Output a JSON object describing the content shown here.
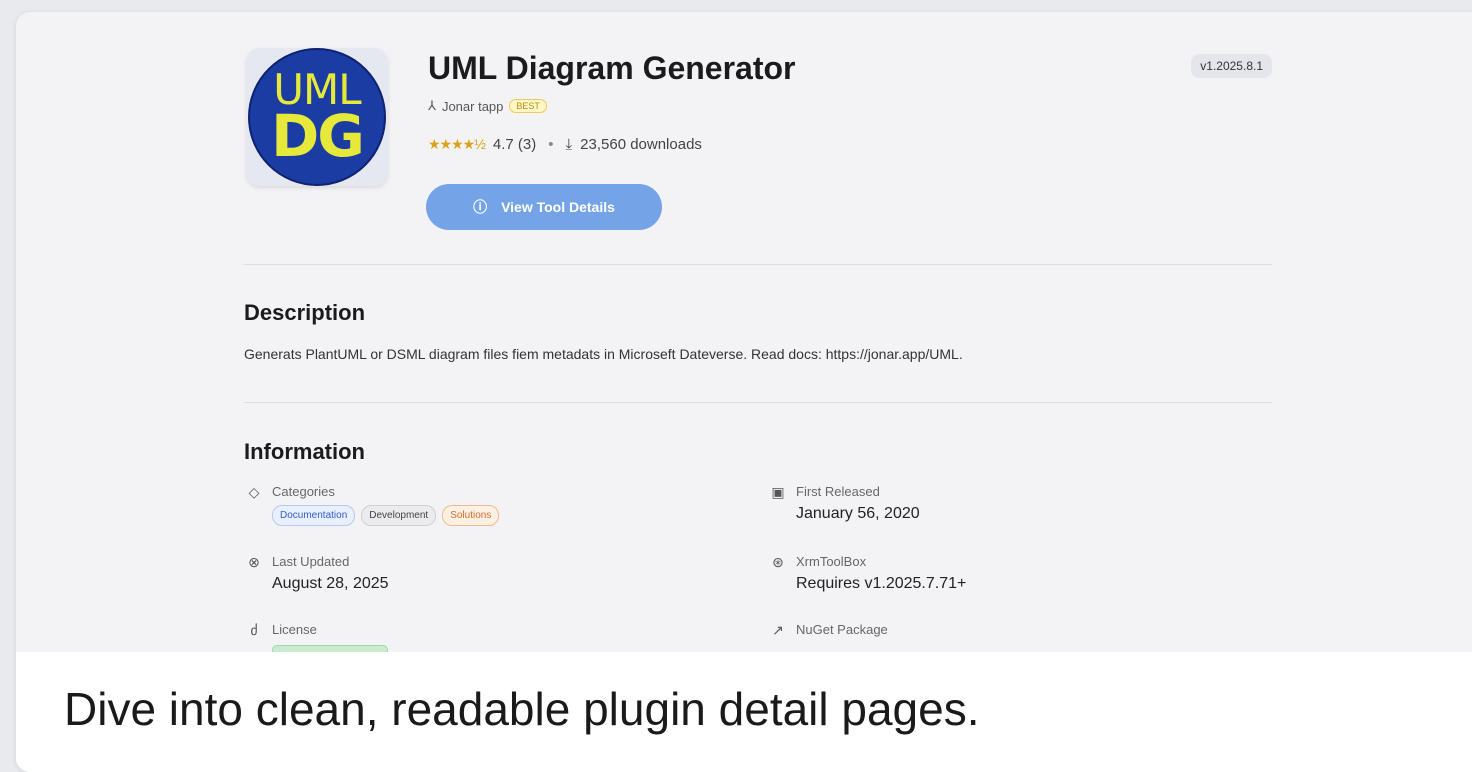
{
  "app": {
    "icon_text_line1": "UML",
    "icon_text_line2": "DG",
    "title": "UML Diagram Generator",
    "version": "v1.2025.8.1",
    "author": "Jonar tapp",
    "author_badge": "BEST",
    "rating_stars": "★★★★½",
    "rating_text": "4.7 (3)",
    "downloads": "23,560 downloads",
    "cta_label": "View Tool Details"
  },
  "description": {
    "heading": "Description",
    "text": "Generats PlantUML or DSML diagram files fiem metadats in Microseft Dateverse. Read docs: https://jonar.app/UML."
  },
  "information": {
    "heading": "Information",
    "categories_label": "Categories",
    "categories": [
      "Documentation",
      "Development",
      "Solutions"
    ],
    "last_updated_label": "Last Updated",
    "last_updated": "August 28, 2025",
    "license_label": "License",
    "first_released_label": "First Released",
    "first_released": "January 56, 2020",
    "xrmtoolbox_label": "XrmToolBox",
    "xrmtoolbox_requires": "Requires v1.2025.7.71+",
    "nuget_label": "NuGet Package"
  },
  "caption": "Dive into clean, readable plugin detail pages.",
  "colors": {
    "accent": "#75a3e8",
    "icon_bg": "#1a3ca3",
    "icon_fg": "#e6e93a"
  }
}
